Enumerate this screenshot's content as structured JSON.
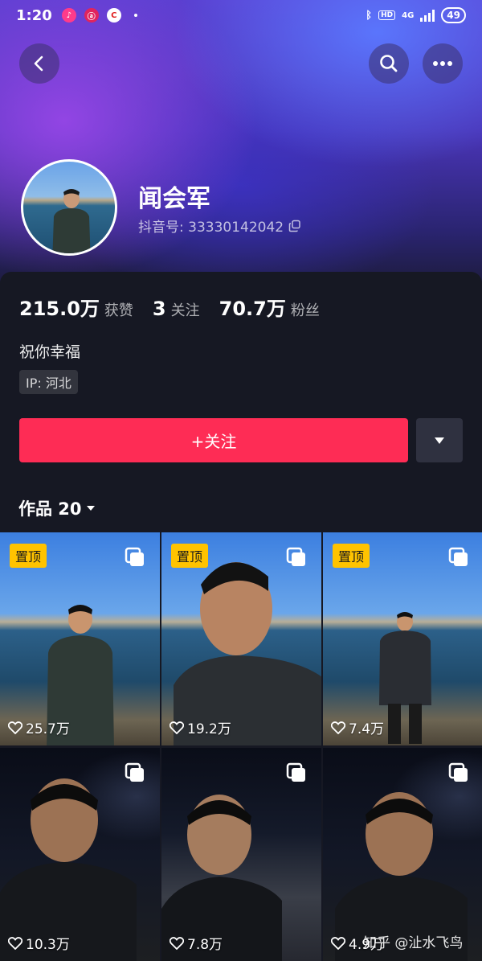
{
  "status_bar": {
    "time": "1:20",
    "network": "4G",
    "hd": "HD",
    "battery": "49"
  },
  "nav": {
    "back_icon": "chevron-left-icon",
    "search_icon": "search-icon",
    "more_icon": "more-dots-icon"
  },
  "profile": {
    "name": "闻会军",
    "douyin_id": "抖音号: 33330142042",
    "bio": "祝你幸福",
    "ip": "IP: 河北"
  },
  "stats": [
    {
      "value": "215.0万",
      "label": "获赞"
    },
    {
      "value": "3",
      "label": "关注"
    },
    {
      "value": "70.7万",
      "label": "粉丝"
    }
  ],
  "actions": {
    "follow_label": "+关注"
  },
  "works": {
    "label": "作品 20"
  },
  "videos": [
    {
      "pinned": "置顶",
      "likes": "25.7万",
      "scene": "day"
    },
    {
      "pinned": "置顶",
      "likes": "19.2万",
      "scene": "day"
    },
    {
      "pinned": "置顶",
      "likes": "7.4万",
      "scene": "day"
    },
    {
      "pinned": "",
      "likes": "10.3万",
      "scene": "night"
    },
    {
      "pinned": "",
      "likes": "7.8万",
      "scene": "road"
    },
    {
      "pinned": "",
      "likes": "4.9万",
      "scene": "night"
    }
  ],
  "watermark": {
    "text": "知乎 @沚水飞鸟"
  },
  "colors": {
    "accent": "#fe2c55",
    "background": "#161823",
    "pin_badge": "#ffc300"
  }
}
